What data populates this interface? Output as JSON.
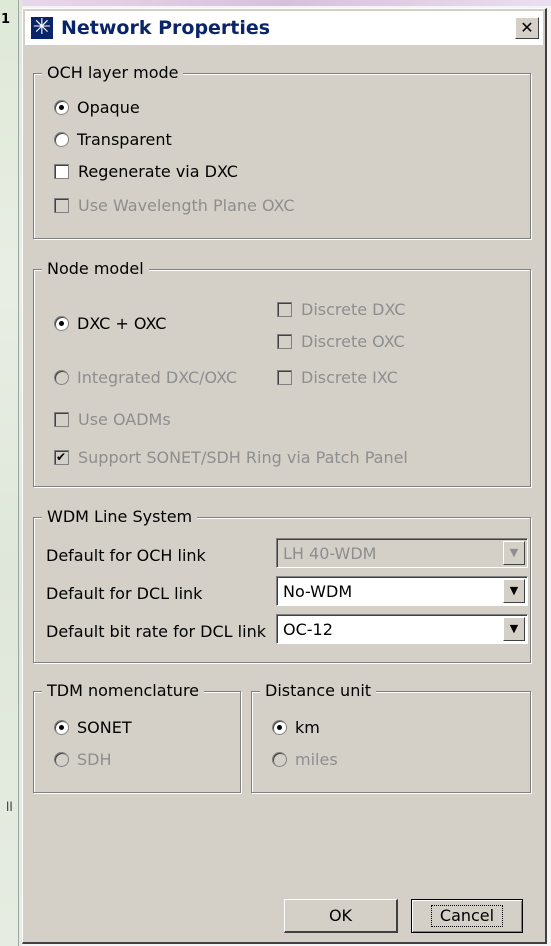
{
  "background": {
    "left_marker": "1",
    "side_marker": "ll"
  },
  "window": {
    "title": "Network Properties",
    "close_glyph": "✕",
    "icon": "network-star-icon"
  },
  "och_layer_mode": {
    "title": "OCH layer mode",
    "opaque": "Opaque",
    "transparent": "Transparent",
    "regenerate": "Regenerate via DXC",
    "wavelength_plane": "Use Wavelength Plane OXC"
  },
  "node_model": {
    "title": "Node model",
    "dxc_oxc": "DXC + OXC",
    "integrated": "Integrated DXC/OXC",
    "discrete_dxc": "Discrete DXC",
    "discrete_oxc": "Discrete OXC",
    "discrete_ixc": "Discrete IXC",
    "use_oadms": "Use OADMs",
    "support_sonet": "Support SONET/SDH Ring via Patch Panel"
  },
  "wdm_line_system": {
    "title": "WDM Line System",
    "och_label": "Default for OCH link",
    "och_value": "LH 40-WDM",
    "dcl_label": "Default for DCL link",
    "dcl_value": "No-WDM",
    "bitrate_label": "Default bit rate for DCL link",
    "bitrate_value": "OC-12"
  },
  "tdm_nomenclature": {
    "title": "TDM nomenclature",
    "sonet": "SONET",
    "sdh": "SDH"
  },
  "distance_unit": {
    "title": "Distance unit",
    "km": "km",
    "miles": "miles"
  },
  "buttons": {
    "ok": "OK",
    "cancel": "Cancel"
  },
  "colors": {
    "dialog_face": "#d4d0c8",
    "title_text": "#0a246a",
    "disabled_text": "#8e8e8e"
  }
}
